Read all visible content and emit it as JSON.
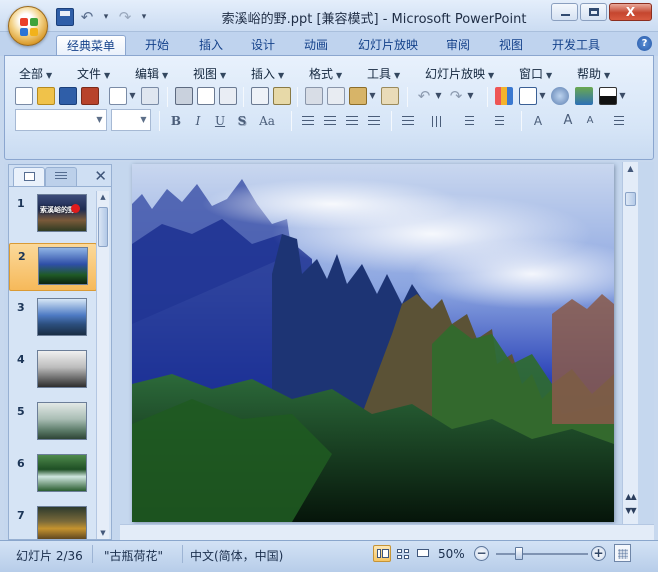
{
  "window": {
    "title": "索溪峪的野.ppt [兼容模式] - Microsoft PowerPoint",
    "close_glyph": "X"
  },
  "quick_access": {
    "icons": [
      "save-icon",
      "undo-icon",
      "redo-icon",
      "customize-dropdown-icon"
    ]
  },
  "ribbon_tabs": [
    {
      "label": "经典菜单",
      "active": true
    },
    {
      "label": "开始",
      "active": false
    },
    {
      "label": "插入",
      "active": false
    },
    {
      "label": "设计",
      "active": false
    },
    {
      "label": "动画",
      "active": false
    },
    {
      "label": "幻灯片放映",
      "active": false
    },
    {
      "label": "审阅",
      "active": false
    },
    {
      "label": "视图",
      "active": false
    },
    {
      "label": "开发工具",
      "active": false
    }
  ],
  "help_glyph": "?",
  "classic_menu": [
    {
      "label": "全部"
    },
    {
      "label": "文件"
    },
    {
      "label": "编辑"
    },
    {
      "label": "视图"
    },
    {
      "label": "插入"
    },
    {
      "label": "格式"
    },
    {
      "label": "工具"
    },
    {
      "label": "幻灯片放映"
    },
    {
      "label": "窗口"
    },
    {
      "label": "帮助"
    }
  ],
  "format_toolbar": {
    "font_name": "",
    "font_size": "",
    "bold": "B",
    "italic": "I",
    "underline": "U",
    "shadow": "S",
    "change_case": "Aa"
  },
  "slides_panel": {
    "tabs": [
      "slides-tab",
      "outline-tab"
    ],
    "close_glyph": "✕",
    "thumbnails": [
      {
        "number": "1",
        "caption": "索溪峪的野",
        "selected": false
      },
      {
        "number": "2",
        "caption": "",
        "selected": true
      },
      {
        "number": "3",
        "caption": "",
        "selected": false
      },
      {
        "number": "4",
        "caption": "",
        "selected": false
      },
      {
        "number": "5",
        "caption": "",
        "selected": false
      },
      {
        "number": "6",
        "caption": "",
        "selected": false
      },
      {
        "number": "7",
        "caption": "",
        "selected": false
      }
    ]
  },
  "status_bar": {
    "slide_info": "幻灯片 2/36",
    "theme": "\"古瓶荷花\"",
    "language": "中文(简体，中国)",
    "zoom": "50%",
    "zoom_fraction": 0.5
  },
  "colors": {
    "ribbon_active_tab": "#ffffff",
    "selected_thumbnail": "#f6b95a",
    "accent_blue": "#15428b"
  }
}
